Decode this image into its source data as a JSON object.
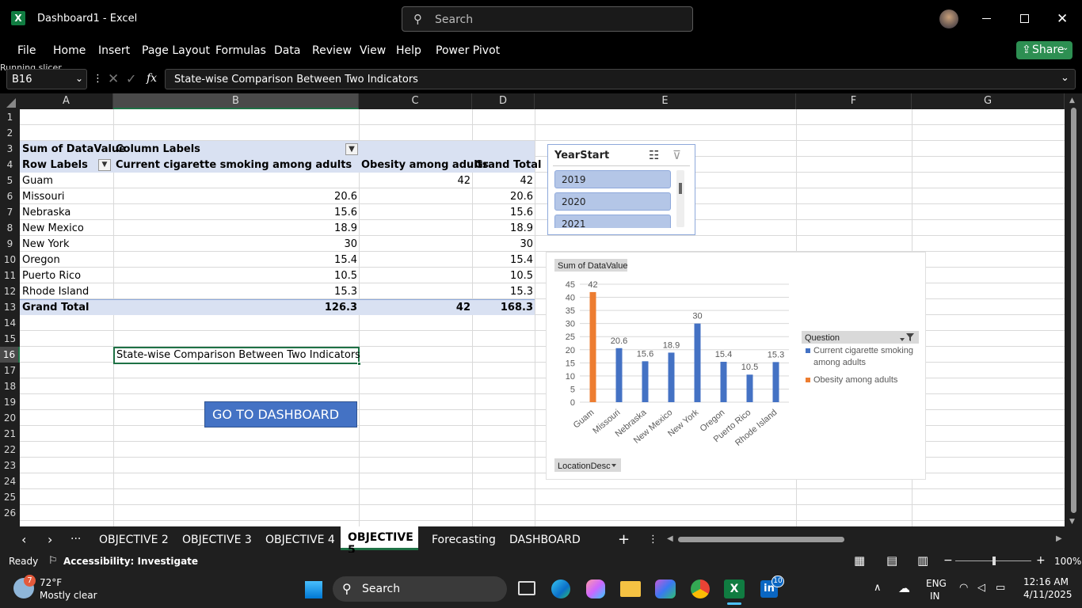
{
  "window": {
    "title": "Dashboard1  -  Excel",
    "search_placeholder": "Search",
    "share_label": "Share"
  },
  "ribbon": {
    "tabs": [
      "File",
      "Home",
      "Insert",
      "Page Layout",
      "Formulas",
      "Data",
      "Review",
      "View",
      "Help",
      "Power Pivot"
    ]
  },
  "overlay_text": "Running slicer operation...",
  "formula_bar": {
    "name_box": "B16",
    "fx": "fx",
    "content": "State-wise Comparison Between Two Indicators"
  },
  "columns": [
    "A",
    "B",
    "C",
    "D",
    "E",
    "F",
    "G"
  ],
  "rows": [
    "1",
    "2",
    "3",
    "4",
    "5",
    "6",
    "7",
    "8",
    "9",
    "10",
    "11",
    "12",
    "13",
    "14",
    "15",
    "16",
    "17",
    "18",
    "19",
    "20",
    "21",
    "22",
    "23",
    "24",
    "25",
    "26"
  ],
  "pivot": {
    "corner": "Sum of DataValue",
    "col_labels": "Column Labels",
    "row_labels": "Row Labels",
    "headers": [
      "Current cigarette smoking among adults",
      "Obesity among adults",
      "Grand Total"
    ],
    "rows": [
      {
        "label": "Guam",
        "b": "",
        "c": "42",
        "d": "42"
      },
      {
        "label": "Missouri",
        "b": "20.6",
        "c": "",
        "d": "20.6"
      },
      {
        "label": "Nebraska",
        "b": "15.6",
        "c": "",
        "d": "15.6"
      },
      {
        "label": "New Mexico",
        "b": "18.9",
        "c": "",
        "d": "18.9"
      },
      {
        "label": "New York",
        "b": "30",
        "c": "",
        "d": "30"
      },
      {
        "label": "Oregon",
        "b": "15.4",
        "c": "",
        "d": "15.4"
      },
      {
        "label": "Puerto Rico",
        "b": "10.5",
        "c": "",
        "d": "10.5"
      },
      {
        "label": "Rhode Island",
        "b": "15.3",
        "c": "",
        "d": "15.3"
      }
    ],
    "total": {
      "label": "Grand Total",
      "b": "126.3",
      "c": "42",
      "d": "168.3"
    }
  },
  "cell_b16": "State-wise Comparison Between Two Indicators",
  "dashboard_button": "GO TO DASHBOARD",
  "slicer": {
    "title": "YearStart",
    "items": [
      "2019",
      "2020",
      "2021"
    ]
  },
  "chart_data": {
    "type": "bar",
    "field_button": "Sum of DataValue",
    "axis_button": "LocationDesc",
    "categories": [
      "Guam",
      "Missouri",
      "Nebraska",
      "New Mexico",
      "New York",
      "Oregon",
      "Puerto Rico",
      "Rhode Island"
    ],
    "values": [
      42,
      20.6,
      15.6,
      18.9,
      30,
      15.4,
      10.5,
      15.3
    ],
    "value_labels": [
      "42",
      "20.6",
      "15.6",
      "18.9",
      "30",
      "15.4",
      "10.5",
      "15.3"
    ],
    "series_index": [
      1,
      0,
      0,
      0,
      0,
      0,
      0,
      0
    ],
    "ylim": [
      0,
      45
    ],
    "yticks": [
      "0",
      "5",
      "10",
      "15",
      "20",
      "25",
      "30",
      "35",
      "40",
      "45"
    ],
    "legend_title": "Question",
    "legend": [
      "Current cigarette smoking among adults",
      "Obesity among adults"
    ],
    "legend_lines": [
      [
        "Current cigarette smoking",
        "among adults"
      ],
      [
        "Obesity among adults"
      ]
    ],
    "colors": [
      "#4472c4",
      "#ed7d31"
    ],
    "grid": true,
    "legend_position": "right"
  },
  "sheet_tabs": [
    "OBJECTIVE 2",
    "OBJECTIVE 3",
    "OBJECTIVE 4",
    "OBJECTIVE 5",
    "Forecasting",
    "DASHBOARD"
  ],
  "active_tab": "OBJECTIVE 5",
  "status": {
    "ready": "Ready",
    "accessibility": "Accessibility: Investigate",
    "zoom": "100%"
  },
  "taskbar": {
    "temp": "72°F",
    "weather": "Mostly clear",
    "badge": "7",
    "search": "Search",
    "lang1": "ENG",
    "lang2": "IN",
    "time": "12:16 AM",
    "date": "4/11/2025",
    "li_badge": "10",
    "m365": "M365"
  }
}
